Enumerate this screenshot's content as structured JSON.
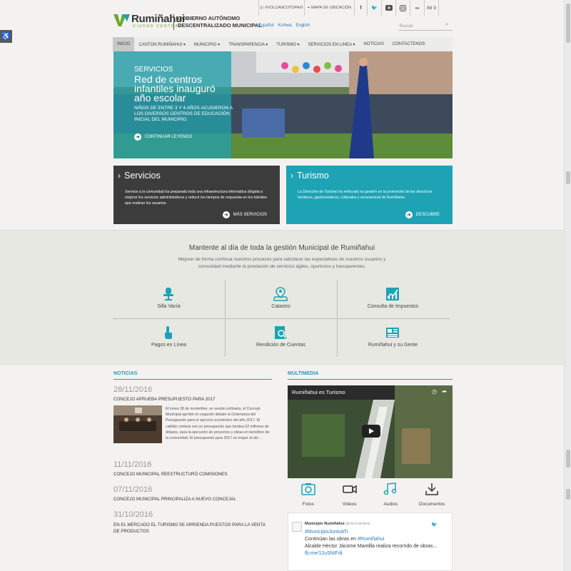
{
  "colors": {
    "teal": "#1ea3b5",
    "dark_box": "#3c3c3c",
    "hero_overlay": "#24a0aa",
    "link": "#2a7ab9"
  },
  "header": {
    "logo_name": "Rumiñahui",
    "logo_tagline": "CIUDAD CENTRAL",
    "gov_line1": "GOBIERNO AUTÓNOMO",
    "gov_line2": "DESCENTRALIZADO MUNICIPAL",
    "top_links": [
      {
        "label": "#VOLCANCOTOPAXI",
        "icon": "location-icon"
      },
      {
        "label": "MAPA DE UBICACIÓN",
        "icon": "map-icon"
      }
    ],
    "social_icons": [
      "facebook-icon",
      "twitter-icon",
      "youtube-icon",
      "instagram-icon",
      "flickr-icon"
    ],
    "extra_icon_label": "88 9",
    "languages": [
      "Español",
      "Kichwa",
      "English"
    ],
    "search_placeholder": "Buscar"
  },
  "nav": [
    {
      "label": "INICIO",
      "active": true
    },
    {
      "label": "CANTON RUMIÑAHUI ▾"
    },
    {
      "label": "MUNICIPIO ▾"
    },
    {
      "label": "TRANSPARENCIA ▾"
    },
    {
      "label": "TURISMO ▾"
    },
    {
      "label": "SERVICIOS EN LINEA ▾"
    },
    {
      "label": "NOTICIAS"
    },
    {
      "label": "CONTACTENOS"
    }
  ],
  "hero": {
    "kicker": "SERVICIOS",
    "title": "Red de centros infantiles inauguró año escolar",
    "desc": "NIÑOS DE ENTRE 3 Y 4 AÑOS ACUDIERON A LOS DIVERSOS CENTROS DE EDUCACIÓN INICIAL DEL MUNICIPIO.",
    "more": "CONTINUAR LEYENDO"
  },
  "boxes": [
    {
      "title": "Servicios",
      "text": "Servicio a la comunidad ha preparado toda una infraestructura informática dirigida a mejorar los servicios administrativos y reducir los tiempos de respuesta en los trámites que realizan los usuarios.",
      "link": "MÁS SERVICIOS"
    },
    {
      "title": "Turismo",
      "text": "La Dirección de Turismo ha enfocado su gestión en la promoción de los atractivos turísticos, gastronómicos, culturales y recreacional de Rumiñahui.",
      "link": "DESCUBRE"
    }
  ],
  "band": {
    "title": "Mantente al día de toda la gestión Municipal de Rumiñahui",
    "subtitle": "Mejorar de forma continua nuestros procesos para satisfacer las expectativas de nuestros usuarios y comunidad mediante la prestación de servicios ágiles, oportunos y transparentes."
  },
  "grid": [
    {
      "label": "Silla Vacía",
      "icon": "chair-icon"
    },
    {
      "label": "Catastro",
      "icon": "map-pin-icon"
    },
    {
      "label": "Consulta de Impuestos",
      "icon": "chart-icon"
    },
    {
      "label": "Pagos en Línea",
      "icon": "touch-icon"
    },
    {
      "label": "Rendición de Cuentas",
      "icon": "document-search-icon"
    },
    {
      "label": "Rumiñahui y su Gente",
      "icon": "newspaper-icon"
    }
  ],
  "news": {
    "heading": "NOTICIAS",
    "items": [
      {
        "date": "28/11/2016",
        "title": "CONCEJO APRUEBA PRESUPUESTO PARA 2017",
        "body": "El lunes 28 de noviembre, en sesión ordinaria, el Concejo Municipal aprobó en segundo debate la Ordenanza del Presupuesto para el ejercicio económico del año 2017. El cabildo contará con un presupuesto que bordea 52 millones de dólares, para la ejecución de proyectos y obras en beneficio de la comunidad. El presupuesto para 2017 es mayor al del ..."
      },
      {
        "date": "11/11/2016",
        "title": "CONCEJO MUNICIPAL REESTRUCTURÓ COMISIONES"
      },
      {
        "date": "07/11/2016",
        "title": "CONCEJO MUNICIPAL PRINCIPALIZA A NUEVO CONCEJAL"
      },
      {
        "date": "31/10/2016",
        "title": "EN EL MERCADO EL TURISMO SE ARRIENDA PUESTOS PARA LA VENTA DE PRODUCTOS"
      }
    ]
  },
  "multimedia": {
    "heading": "MULTIMEDIA",
    "video_title": "Rumiñahui es Turismo",
    "items": [
      {
        "label": "Fotos",
        "icon": "camera-icon"
      },
      {
        "label": "Videos",
        "icon": "video-camera-icon"
      },
      {
        "label": "Audios",
        "icon": "music-icon"
      },
      {
        "label": "Documentos",
        "icon": "download-icon"
      }
    ]
  },
  "tweet": {
    "name": "Municipio Rumiñahui",
    "handle": "@mruminahui",
    "hashtag1": "#MunicipioJuntoATi",
    "line2a": "Continúan las obras en ",
    "hashtag2": "#Rumiñahui",
    "line3": "Alcalde Héctor Jácome Mantilla realiza recorrido de obras... ",
    "link": "fb.me/12uSNIFdi"
  }
}
